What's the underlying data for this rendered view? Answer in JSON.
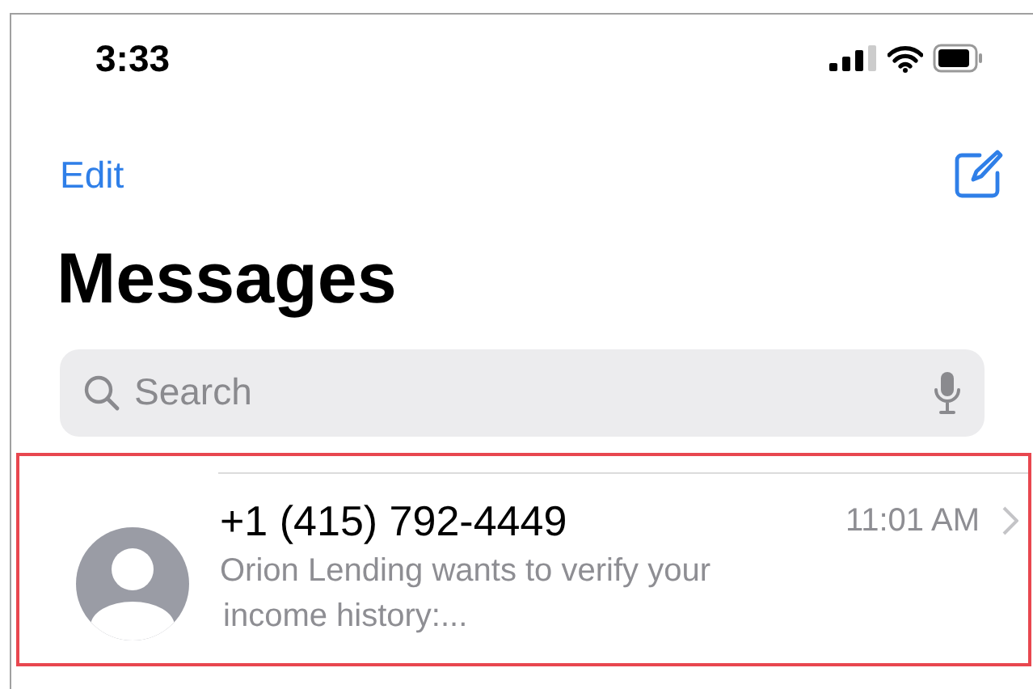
{
  "status_bar": {
    "time": "3:33"
  },
  "nav": {
    "edit": "Edit"
  },
  "title": "Messages",
  "search": {
    "placeholder": "Search"
  },
  "conversations": [
    {
      "name": "+1 (415) 792-4449",
      "time": "11:01 AM",
      "preview": "Orion Lending wants to verify your",
      "preview_2": "income history:...",
      "highlighted": true
    }
  ]
}
